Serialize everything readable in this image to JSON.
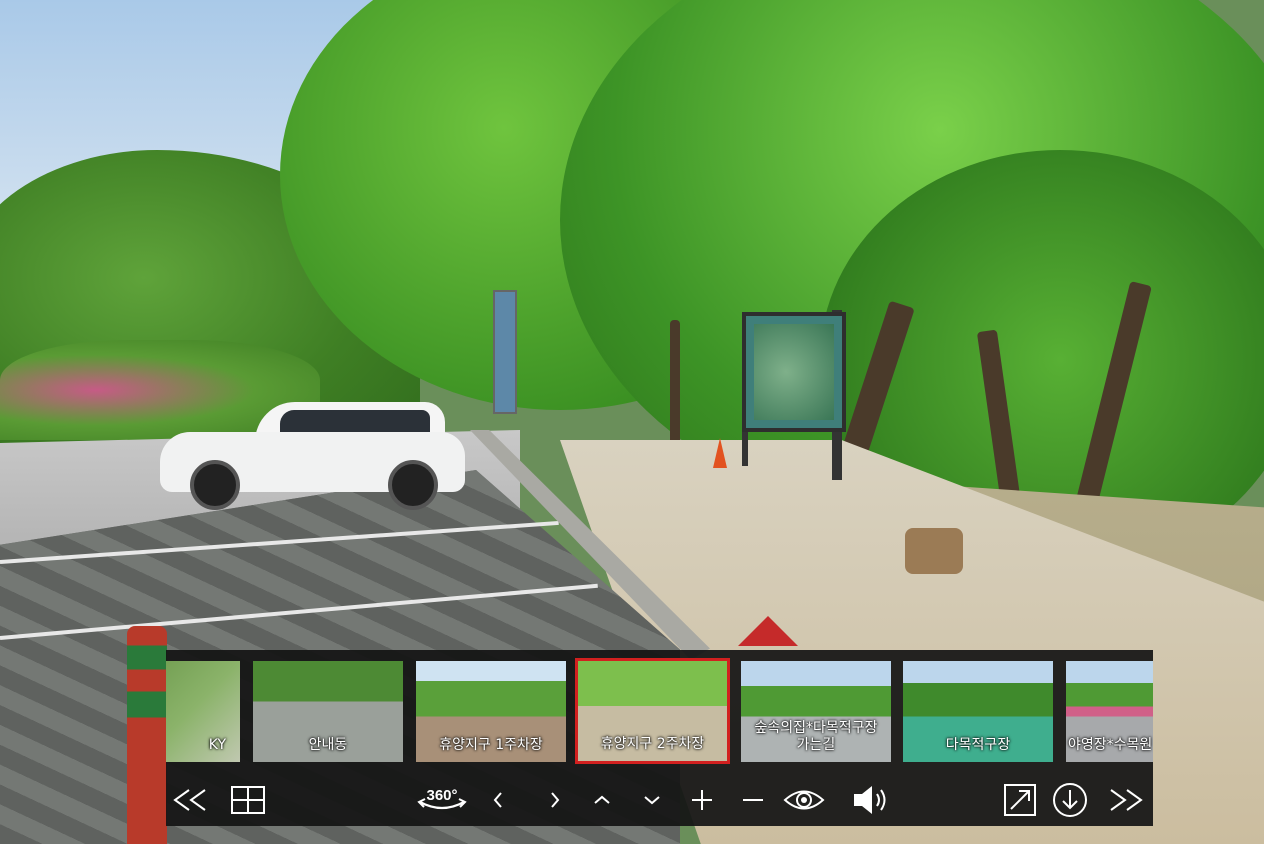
{
  "app": {
    "title": "휴양지구 2주차장"
  },
  "thumbnails": [
    {
      "label": "KY",
      "selected": false
    },
    {
      "label": "안내동",
      "selected": false
    },
    {
      "label": "휴양지구 1주차장",
      "selected": false
    },
    {
      "label": "휴양지구 2주차장",
      "selected": true
    },
    {
      "label": "숲속의집*다목적구장\n가는길",
      "selected": false
    },
    {
      "label": "다목적구장",
      "selected": false
    },
    {
      "label": "야영장*수목원",
      "selected": false
    }
  ],
  "toolbar": {
    "buttons": [
      {
        "name": "previous-scene-button",
        "icon": "double-left-icon"
      },
      {
        "name": "thumbnails-toggle-button",
        "icon": "grid-icon"
      },
      {
        "name": "autorotate-360-button",
        "icon": "rotate-360-icon",
        "text": "360°"
      },
      {
        "name": "pan-left-button",
        "icon": "chevron-left-icon"
      },
      {
        "name": "pan-right-button",
        "icon": "chevron-right-icon"
      },
      {
        "name": "pan-up-button",
        "icon": "chevron-up-icon"
      },
      {
        "name": "pan-down-button",
        "icon": "chevron-down-icon"
      },
      {
        "name": "zoom-in-button",
        "icon": "plus-icon"
      },
      {
        "name": "zoom-out-button",
        "icon": "minus-icon"
      },
      {
        "name": "view-mode-button",
        "icon": "eye-icon"
      },
      {
        "name": "sound-button",
        "icon": "speaker-icon"
      },
      {
        "name": "fullscreen-button",
        "icon": "expand-icon"
      },
      {
        "name": "download-button",
        "icon": "download-circle-icon"
      },
      {
        "name": "next-scene-button",
        "icon": "double-right-icon"
      }
    ]
  },
  "colors": {
    "selected_border": "#d2201f",
    "toolbar_bg": "#141414",
    "pointer": "#c52a2a"
  }
}
